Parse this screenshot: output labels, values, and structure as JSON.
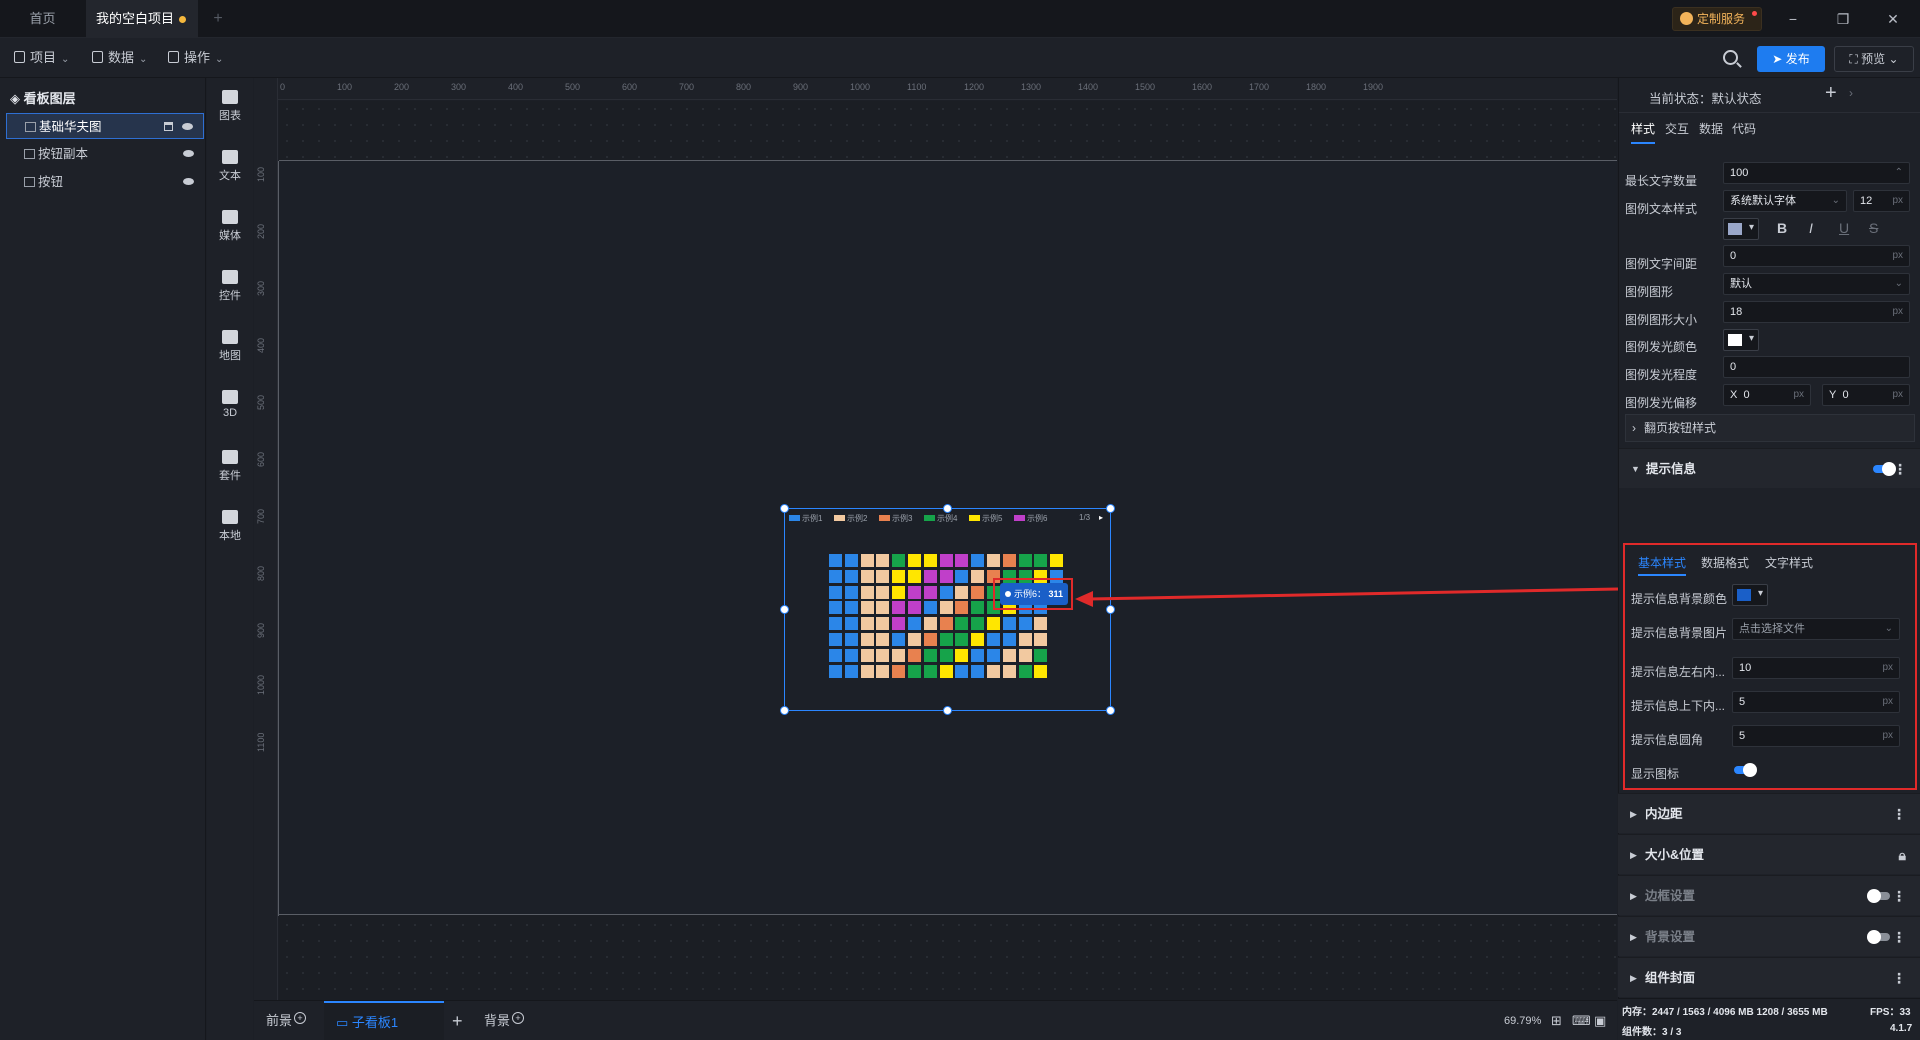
{
  "titlebar": {
    "tab_home": "首页",
    "tab_project": "我的空白项目",
    "custom_service": "定制服务",
    "minimize": "−",
    "maximize": "❐",
    "close": "✕",
    "add_tab": "+"
  },
  "toolbar": {
    "menu_project": "项目",
    "menu_data": "数据",
    "menu_operate": "操作",
    "publish": "发布",
    "preview": "预览"
  },
  "layers": {
    "title": "看板图层",
    "items": [
      "基础华夫图",
      "按钮副本",
      "按钮"
    ]
  },
  "tools": [
    "图表",
    "文本",
    "媒体",
    "控件",
    "地图",
    "3D",
    "套件",
    "本地"
  ],
  "ruler": {
    "h_ticks": [
      "0",
      "100",
      "200",
      "300",
      "400",
      "500",
      "600",
      "700",
      "800",
      "900",
      "1000",
      "1100",
      "1200",
      "1300",
      "1400",
      "1500",
      "1600",
      "1700",
      "1800",
      "1900"
    ],
    "v_ticks": [
      "100",
      "200",
      "300",
      "400",
      "500",
      "600",
      "700",
      "800",
      "900",
      "1000",
      "1100"
    ]
  },
  "widget": {
    "legend": [
      "示例1",
      "示例2",
      "示例3",
      "示例4",
      "示例5",
      "示例6"
    ],
    "legend_colors": [
      "#2b86e8",
      "#f2c9a0",
      "#e8814f",
      "#16a34a",
      "#ffe600",
      "#c03fc9"
    ],
    "page": "1/3",
    "tooltip_name": "示例6：",
    "tooltip_value": "311"
  },
  "bottom": {
    "foreground": "前景",
    "sub_board": "子看板1",
    "background": "背景",
    "zoom": "69.79%"
  },
  "right": {
    "state_label": "当前状态：默认状态",
    "tabs": [
      "样式",
      "交互",
      "数据",
      "代码"
    ],
    "props": [
      {
        "label": "最长文字数量",
        "value": "100"
      },
      {
        "label": "图例文本样式",
        "value": "系统默认字体",
        "size": "12"
      },
      {
        "label": "图例文字间距",
        "value": "0"
      },
      {
        "label": "图例图形",
        "value": "默认"
      },
      {
        "label": "图例图形大小",
        "value": "18"
      },
      {
        "label": "图例发光颜色"
      },
      {
        "label": "图例发光程度",
        "value": "0"
      },
      {
        "label": "图例发光偏移",
        "x": "0",
        "y": "0"
      }
    ],
    "page_btn_style": "翻页按钮样式",
    "tooltip_section": "提示信息",
    "tooltip_tabs": [
      "基本样式",
      "数据格式",
      "文字样式"
    ],
    "tooltip_props": [
      {
        "label": "提示信息背景颜色"
      },
      {
        "label": "提示信息背景图片",
        "value": "点击选择文件"
      },
      {
        "label": "提示信息左右内...",
        "value": "10"
      },
      {
        "label": "提示信息上下内...",
        "value": "5"
      },
      {
        "label": "提示信息圆角",
        "value": "5"
      },
      {
        "label": "显示图标"
      }
    ],
    "sections": [
      "内边距",
      "大小&位置",
      "边框设置",
      "背景设置",
      "组件封面"
    ],
    "unit_px": "px",
    "footer_mem": "内存：2447 / 1563 / 4096 MB  1208 / 3655 MB",
    "footer_fps": "FPS：33",
    "footer_count": "组件数：3 / 3",
    "footer_version": "4.1.7"
  }
}
